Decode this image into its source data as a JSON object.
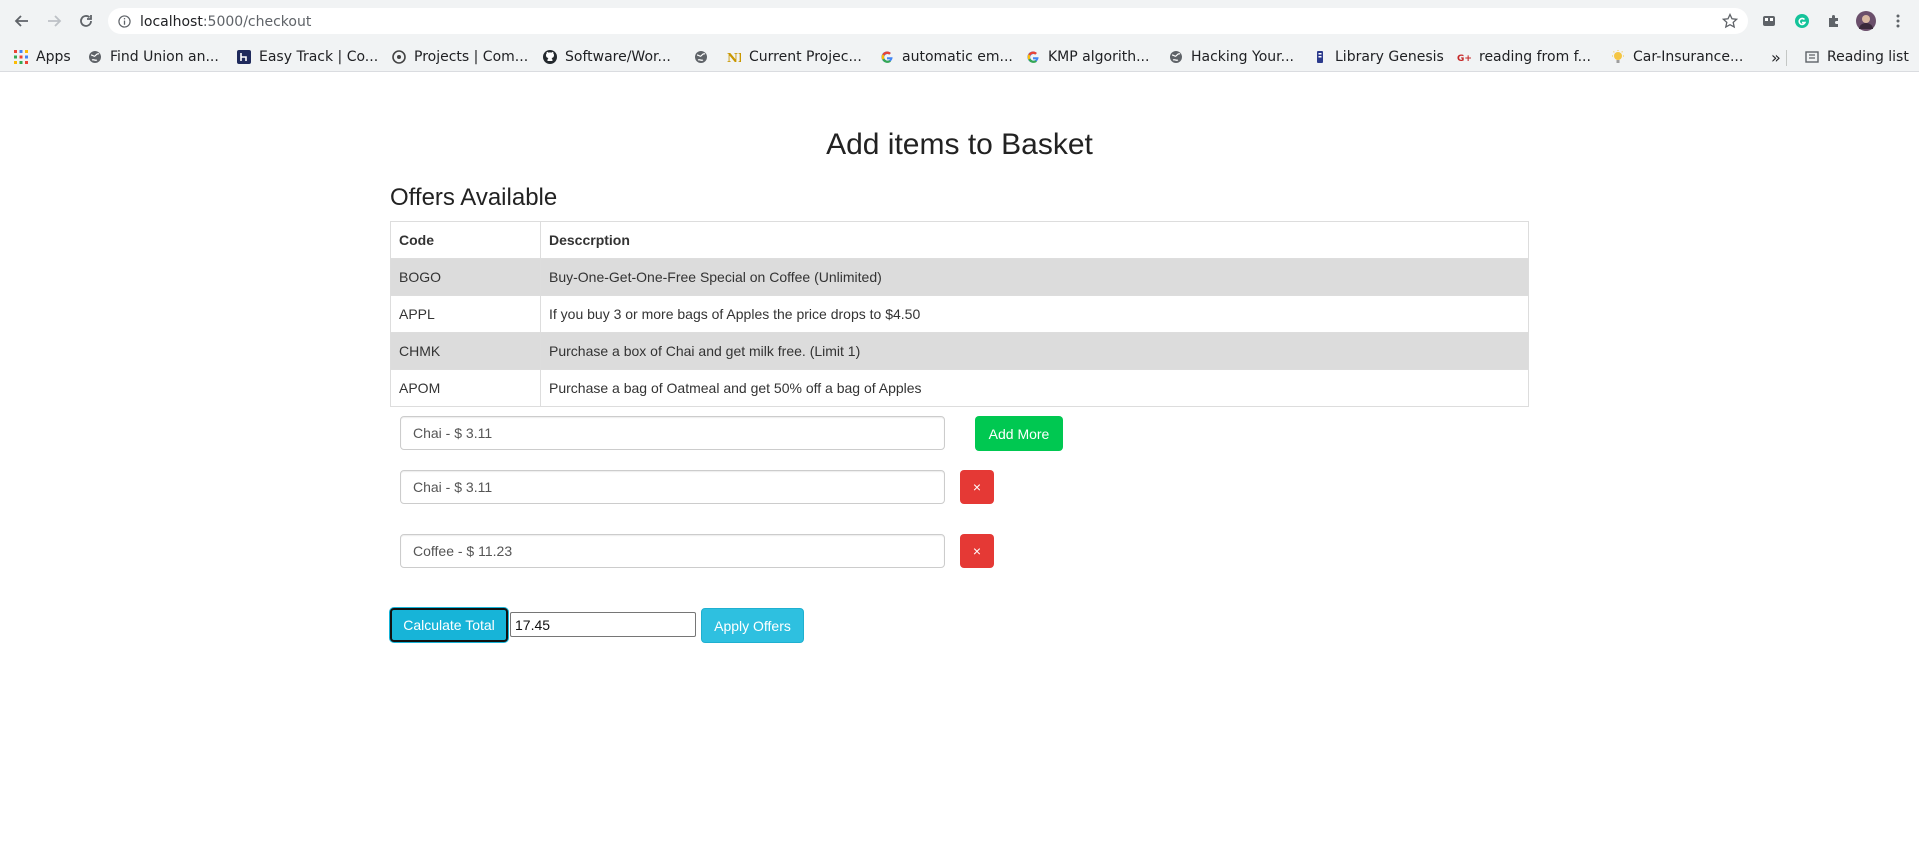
{
  "browser": {
    "url_host": "localhost",
    "url_path": ":5000/checkout",
    "bookmarks": [
      {
        "label": "Apps",
        "icon": "apps-grid-icon"
      },
      {
        "label": "Find Union an...",
        "icon": "globe-icon"
      },
      {
        "label": "Easy Track | Co...",
        "icon": "h-logo-icon"
      },
      {
        "label": "Projects | Com...",
        "icon": "target-icon"
      },
      {
        "label": "Software/Wor...",
        "icon": "github-icon"
      },
      {
        "label": "",
        "icon": "globe-icon"
      },
      {
        "label": "Current Projec...",
        "icon": "nd-logo-icon"
      },
      {
        "label": "automatic em...",
        "icon": "google-icon"
      },
      {
        "label": "KMP algorith...",
        "icon": "google-icon"
      },
      {
        "label": "Hacking Your...",
        "icon": "globe-icon"
      },
      {
        "label": "Library Genesis",
        "icon": "libgen-icon"
      },
      {
        "label": "reading from f...",
        "icon": "geeks-icon"
      },
      {
        "label": "Car-Insurance...",
        "icon": "bulb-icon"
      }
    ],
    "overflow": "»",
    "reading_list": "Reading list"
  },
  "page": {
    "title": "Add items to Basket",
    "offers_title": "Offers Available"
  },
  "offers": {
    "headers": [
      "Code",
      "Desccrption"
    ],
    "rows": [
      {
        "code": "BOGO",
        "description": "Buy-One-Get-One-Free Special on Coffee (Unlimited)"
      },
      {
        "code": "APPL",
        "description": "If you buy 3 or more bags of Apples the price drops to $4.50"
      },
      {
        "code": "CHMK",
        "description": "Purchase a box of Chai and get milk free. (Limit 1)"
      },
      {
        "code": "APOM",
        "description": "Purchase a bag of Oatmeal and get 50% off a bag of Apples"
      }
    ]
  },
  "basket": {
    "items": [
      "Chai - $ 3.11",
      "Chai - $ 3.11",
      "Coffee - $ 11.23"
    ],
    "add_more_label": "Add More",
    "remove_label": "×"
  },
  "totals": {
    "calculate_label": "Calculate Total",
    "total_value": "17.45",
    "apply_label": "Apply Offers"
  },
  "colors": {
    "success": "#00c851",
    "danger": "#e53935",
    "info": "#17b4d8",
    "table_stripe": "#dcdcdc"
  }
}
